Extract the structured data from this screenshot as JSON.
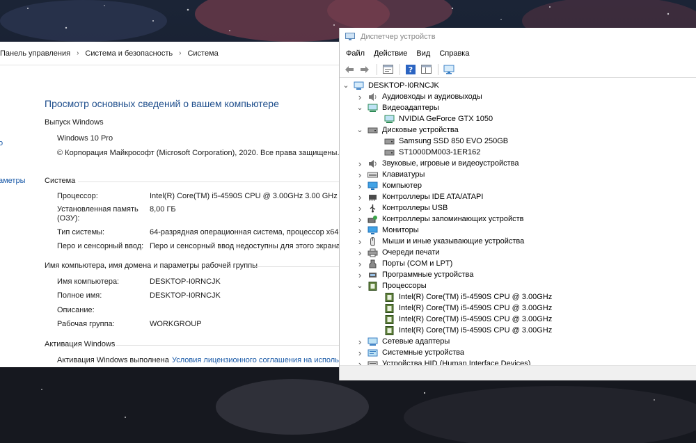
{
  "system_window": {
    "breadcrumb": [
      "Панель управления",
      "Система и безопасность",
      "Система"
    ],
    "left_links": [
      "",
      "о",
      "аметры",
      ""
    ],
    "title": "Просмотр основных сведений о вашем компьютере",
    "edition": {
      "header": "Выпуск Windows",
      "name": "Windows 10 Pro",
      "copyright": "© Корпорация Майкрософт (Microsoft Corporation), 2020. Все права защищены."
    },
    "system": {
      "header": "Система",
      "rows": [
        {
          "label": "Процессор:",
          "value": "Intel(R) Core(TM) i5-4590S CPU @ 3.00GHz   3.00 GHz"
        },
        {
          "label": "Установленная память\n(ОЗУ):",
          "value": "8,00 ГБ"
        },
        {
          "label": "Тип системы:",
          "value": "64-разрядная операционная система, процессор x64"
        },
        {
          "label": "Перо и сенсорный ввод:",
          "value": "Перо и сенсорный ввод недоступны для этого экрана"
        }
      ]
    },
    "computer_name": {
      "header": "Имя компьютера, имя домена и параметры рабочей группы",
      "rows": [
        {
          "label": "Имя компьютера:",
          "value": "DESKTOP-I0RNCJK"
        },
        {
          "label": "Полное имя:",
          "value": "DESKTOP-I0RNCJK"
        },
        {
          "label": "Описание:",
          "value": ""
        },
        {
          "label": "Рабочая группа:",
          "value": "WORKGROUP"
        }
      ]
    },
    "activation": {
      "header": "Активация Windows",
      "status": "Активация Windows выполнена",
      "link": "Условия лицензионного соглашения на использ"
    }
  },
  "device_manager": {
    "title": "Диспетчер устройств",
    "menu": [
      "Файл",
      "Действие",
      "Вид",
      "Справка"
    ],
    "toolbar": [
      "back-icon",
      "forward-icon",
      "properties-icon",
      "help-icon",
      "show-hidden-icon",
      "monitor-scan-icon"
    ],
    "tree": [
      {
        "label": "DESKTOP-I0RNCJK",
        "level": 0,
        "expander": "v",
        "icon": "computer-icon"
      },
      {
        "label": "Аудиовходы и аудиовыходы",
        "level": 1,
        "expander": ">",
        "icon": "audio-icon"
      },
      {
        "label": "Видеоадаптеры",
        "level": 1,
        "expander": "v",
        "icon": "display-adapter-icon"
      },
      {
        "label": "NVIDIA GeForce GTX 1050",
        "level": 2,
        "expander": "",
        "icon": "display-adapter-icon"
      },
      {
        "label": "Дисковые устройства",
        "level": 1,
        "expander": "v",
        "icon": "disk-icon"
      },
      {
        "label": "Samsung SSD 850 EVO 250GB",
        "level": 2,
        "expander": "",
        "icon": "disk-icon"
      },
      {
        "label": "ST1000DM003-1ER162",
        "level": 2,
        "expander": "",
        "icon": "disk-icon"
      },
      {
        "label": "Звуковые, игровые и видеоустройства",
        "level": 1,
        "expander": ">",
        "icon": "speaker-icon"
      },
      {
        "label": "Клавиатуры",
        "level": 1,
        "expander": ">",
        "icon": "keyboard-icon"
      },
      {
        "label": "Компьютер",
        "level": 1,
        "expander": ">",
        "icon": "monitor-icon"
      },
      {
        "label": "Контроллеры IDE ATA/ATAPI",
        "level": 1,
        "expander": ">",
        "icon": "controller-icon"
      },
      {
        "label": "Контроллеры USB",
        "level": 1,
        "expander": ">",
        "icon": "usb-icon"
      },
      {
        "label": "Контроллеры запоминающих устройств",
        "level": 1,
        "expander": ">",
        "icon": "storage-controller-icon"
      },
      {
        "label": "Мониторы",
        "level": 1,
        "expander": ">",
        "icon": "monitor-icon"
      },
      {
        "label": "Мыши и иные указывающие устройства",
        "level": 1,
        "expander": ">",
        "icon": "mouse-icon"
      },
      {
        "label": "Очереди печати",
        "level": 1,
        "expander": ">",
        "icon": "printer-icon"
      },
      {
        "label": "Порты (COM и LPT)",
        "level": 1,
        "expander": ">",
        "icon": "port-icon"
      },
      {
        "label": "Программные устройства",
        "level": 1,
        "expander": ">",
        "icon": "software-device-icon"
      },
      {
        "label": "Процессоры",
        "level": 1,
        "expander": "v",
        "icon": "processor-icon"
      },
      {
        "label": "Intel(R) Core(TM) i5-4590S CPU @ 3.00GHz",
        "level": 2,
        "expander": "",
        "icon": "processor-icon"
      },
      {
        "label": "Intel(R) Core(TM) i5-4590S CPU @ 3.00GHz",
        "level": 2,
        "expander": "",
        "icon": "processor-icon"
      },
      {
        "label": "Intel(R) Core(TM) i5-4590S CPU @ 3.00GHz",
        "level": 2,
        "expander": "",
        "icon": "processor-icon"
      },
      {
        "label": "Intel(R) Core(TM) i5-4590S CPU @ 3.00GHz",
        "level": 2,
        "expander": "",
        "icon": "processor-icon"
      },
      {
        "label": "Сетевые адаптеры",
        "level": 1,
        "expander": ">",
        "icon": "network-icon"
      },
      {
        "label": "Системные устройства",
        "level": 1,
        "expander": ">",
        "icon": "system-device-icon"
      },
      {
        "label": "Устройства HID (Human Interface Devices)",
        "level": 1,
        "expander": ">",
        "icon": "hid-icon"
      }
    ]
  }
}
